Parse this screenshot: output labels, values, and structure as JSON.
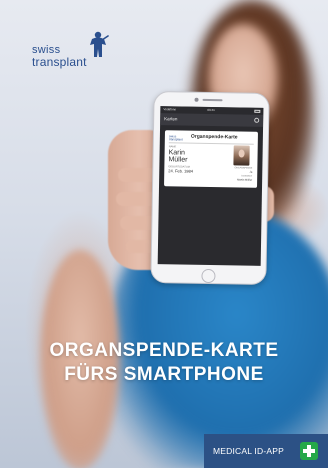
{
  "logo": {
    "line1": "swiss",
    "line2": "transplant"
  },
  "phone": {
    "status": {
      "carrier": "Vodafone",
      "time": "09:41"
    },
    "app_header_title": "Karten",
    "card": {
      "logo_line1": "swiss",
      "logo_line2": "transplant",
      "title": "Organspende-Karte",
      "name_label": "NAME",
      "first_name": "Karin",
      "last_name": "Müller",
      "dob_label": "GEBURTSDATUM",
      "dob": "24. Feb. 1984",
      "right_label_1": "ORGANSPENDE",
      "right_value_1": "Ja",
      "right_label_2": "KONTAKT",
      "right_value_2": "Martin Müller"
    }
  },
  "headline": {
    "line1": "ORGANSPENDE-KARTE",
    "line2": "FÜRS SMARTPHONE"
  },
  "footer": {
    "label": "MEDICAL ID-APP",
    "badge_icon": "plus-icon"
  },
  "colors": {
    "brand_blue": "#2c5185",
    "badge_green": "#25a849",
    "logo_blue": "#2a4f8e"
  }
}
